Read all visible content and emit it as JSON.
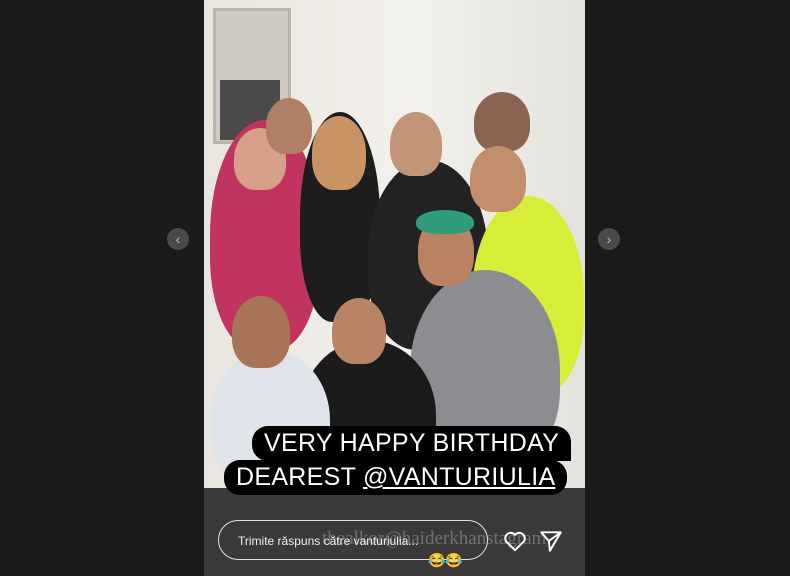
{
  "story": {
    "caption_line1": "VERY HAPPY BIRTHDAY",
    "caption_prefix": "DEAREST ",
    "caption_mention": "@VANTURIULIA",
    "watermark": "thealkor@haiderkhanstagram",
    "emoji": "😂😂"
  },
  "nav": {
    "prev_icon": "chevron-left-icon",
    "next_icon": "chevron-right-icon"
  },
  "reply": {
    "placeholder": "Trimite răspuns către vanturiulia..."
  },
  "actions": {
    "like_icon": "heart-icon",
    "share_icon": "send-icon"
  }
}
